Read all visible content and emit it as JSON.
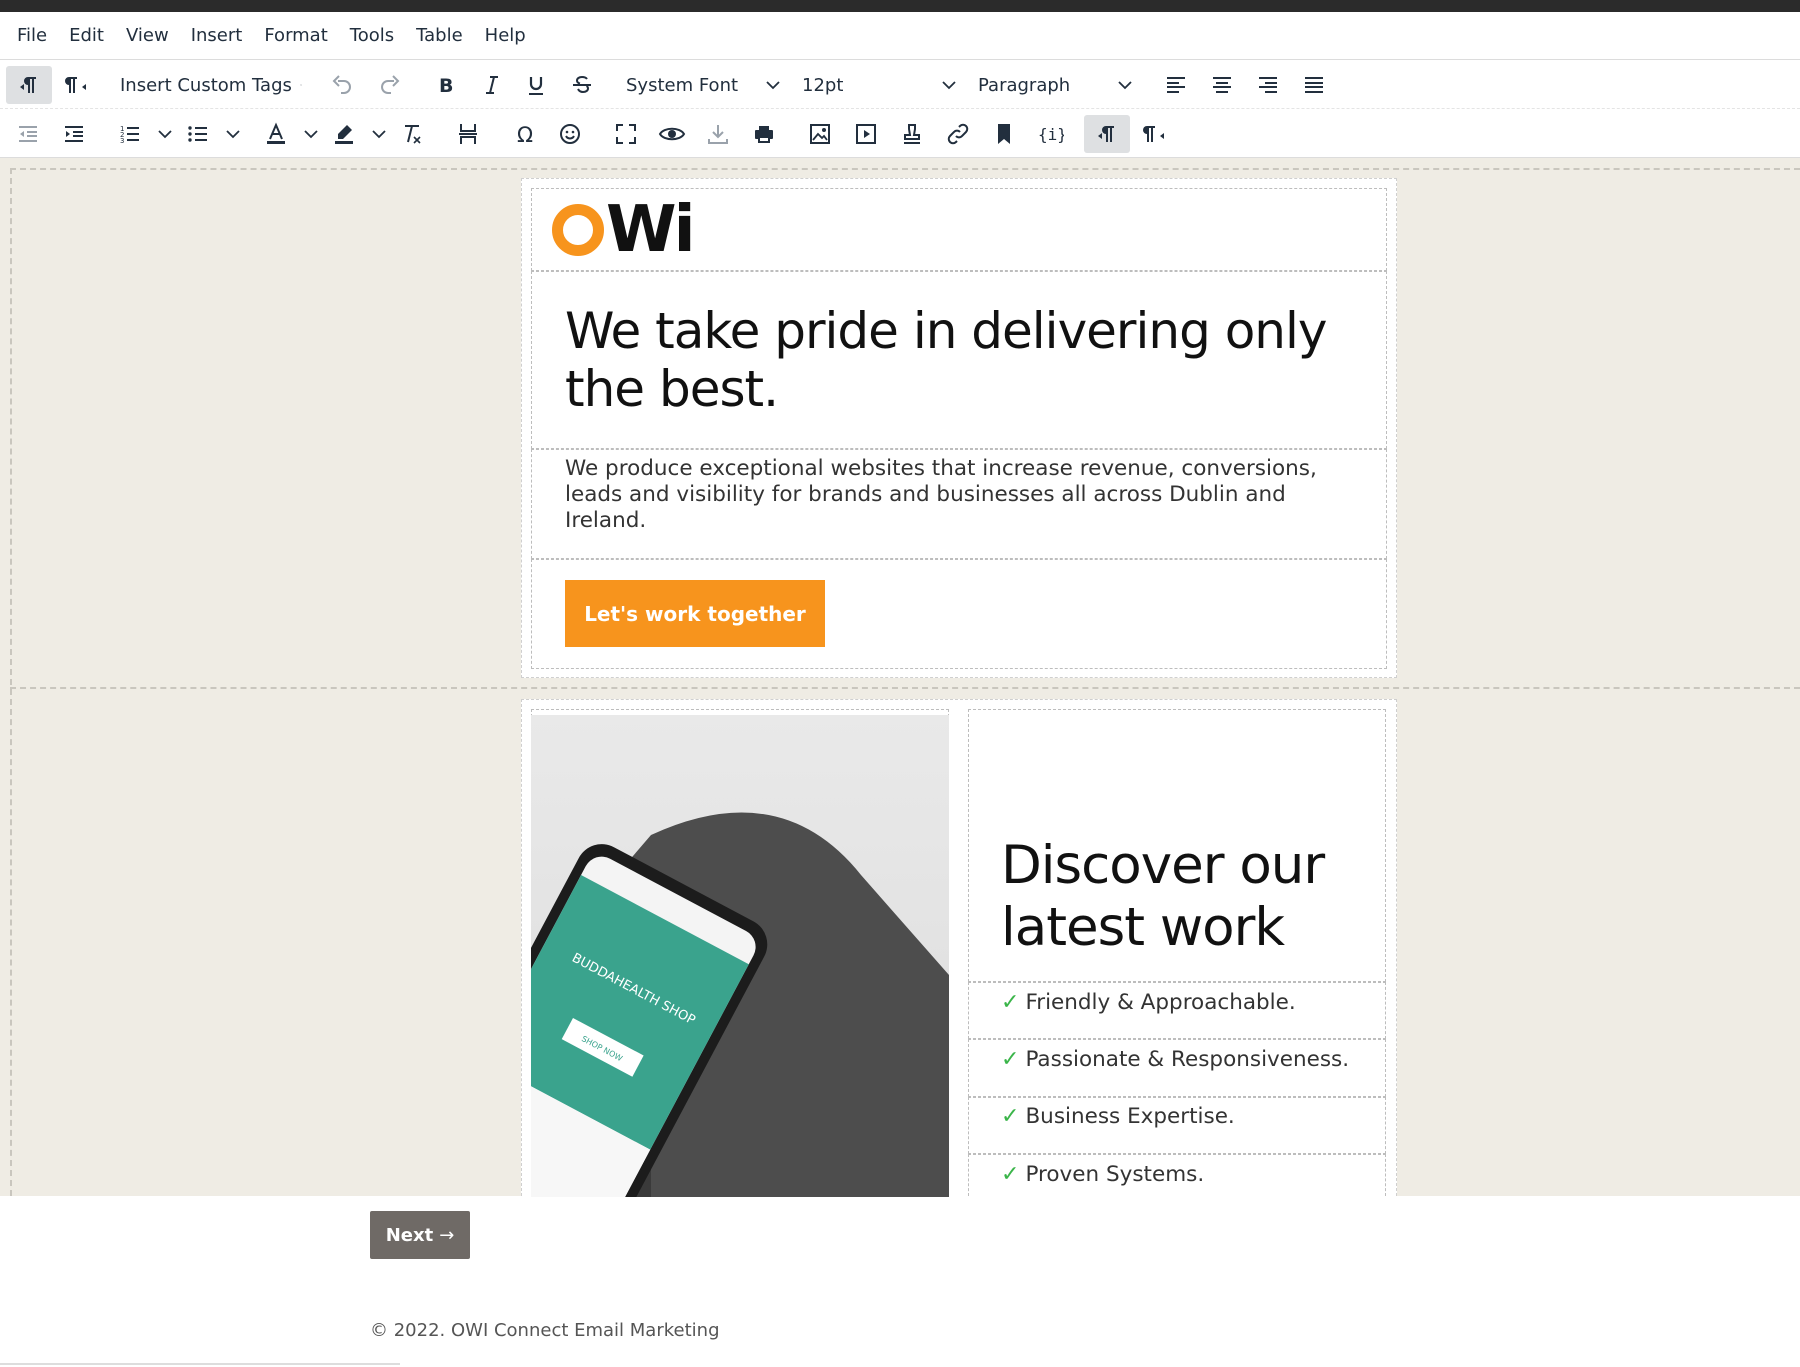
{
  "menubar": {
    "items": [
      "File",
      "Edit",
      "View",
      "Insert",
      "Format",
      "Tools",
      "Table",
      "Help"
    ]
  },
  "toolbar": {
    "custom_tags_label": "Insert Custom Tags",
    "font_family": "System Font",
    "font_size": "12pt",
    "block_format": "Paragraph"
  },
  "email": {
    "logo_text": "Wi",
    "hero_title": "We take pride in delivering only the best.",
    "hero_body": "We produce exceptional websites that increase revenue, conversions, leads and visibility for brands and businesses all across Dublin and Ireland.",
    "cta_label": "Let's work together",
    "discover_title": "Discover our latest work",
    "features": [
      "Friendly & Approachable.",
      "Passionate & Responsiveness.",
      "Business Expertise.",
      "Proven Systems."
    ],
    "check_mark": "✓",
    "phone_screen_brand": "BUDDAHEALTH SHOP",
    "phone_screen_button": "SHOP NOW"
  },
  "page": {
    "next_label": "Next",
    "next_arrow": "→",
    "footer_text": "© 2022. OWI Connect Email Marketing"
  },
  "colors": {
    "accent_orange": "#f7941d",
    "check_green": "#3bb54a",
    "canvas_bg": "#efece4",
    "next_button": "#6f6a66",
    "phone_screen": "#3aa38d"
  }
}
